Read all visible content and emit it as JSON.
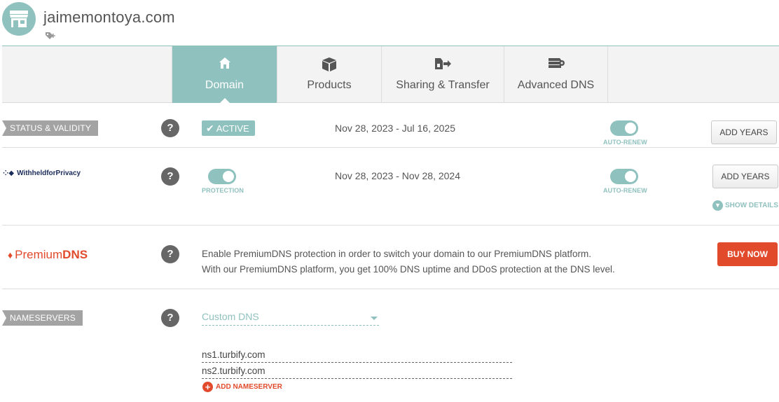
{
  "header": {
    "domain": "jaimemontoya.com",
    "store_icon": "store-icon",
    "tag_icon": "tag-plus-icon"
  },
  "tabs": [
    {
      "label": "Domain",
      "icon": "home-icon",
      "active": true
    },
    {
      "label": "Products",
      "icon": "box-icon",
      "active": false
    },
    {
      "label": "Sharing & Transfer",
      "icon": "transfer-icon",
      "active": false
    },
    {
      "label": "Advanced DNS",
      "icon": "server-icon",
      "active": false
    }
  ],
  "status": {
    "section_label": "STATUS & VALIDITY",
    "badge": "ACTIVE",
    "dates": "Nov 28, 2023 - Jul 16, 2025",
    "toggle_label": "AUTO-RENEW",
    "button": "ADD YEARS"
  },
  "privacy": {
    "brand": "WithheldforPrivacy",
    "protection_label": "PROTECTION",
    "dates": "Nov 28, 2023 - Nov 28, 2024",
    "toggle_label": "AUTO-RENEW",
    "button": "ADD YEARS",
    "show_details": "SHOW DETAILS"
  },
  "premium_dns": {
    "brand_prefix": "Premium",
    "brand_suffix": "DNS",
    "line1": "Enable PremiumDNS protection in order to switch your domain to our PremiumDNS platform.",
    "line2": "With our PremiumDNS platform, you get 100% DNS uptime and DDoS protection at the DNS level.",
    "button": "BUY NOW"
  },
  "nameservers": {
    "section_label": "NAMESERVERS",
    "selected": "Custom DNS",
    "entries": [
      "ns1.turbify.com",
      "ns2.turbify.com"
    ],
    "add_label": "ADD NAMESERVER"
  },
  "help_symbol": "?",
  "colors": {
    "accent": "#8fc1be",
    "danger": "#e24a2c",
    "tag_gray": "#a3a3a3"
  }
}
